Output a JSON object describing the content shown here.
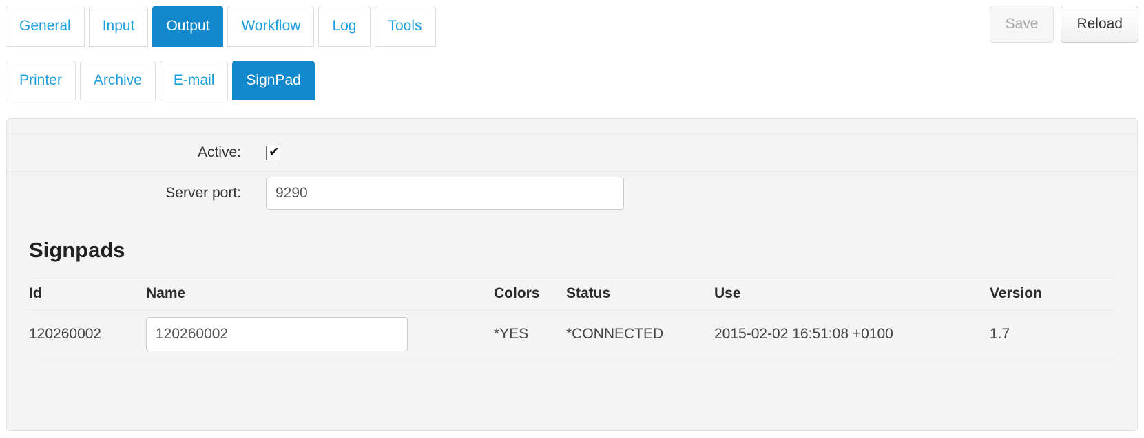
{
  "primary_tabs": [
    {
      "label": "General",
      "active": false
    },
    {
      "label": "Input",
      "active": false
    },
    {
      "label": "Output",
      "active": true
    },
    {
      "label": "Workflow",
      "active": false
    },
    {
      "label": "Log",
      "active": false
    },
    {
      "label": "Tools",
      "active": false
    }
  ],
  "secondary_tabs": [
    {
      "label": "Printer",
      "active": false
    },
    {
      "label": "Archive",
      "active": false
    },
    {
      "label": "E-mail",
      "active": false
    },
    {
      "label": "SignPad",
      "active": true
    }
  ],
  "toolbar": {
    "save_label": "Save",
    "reload_label": "Reload"
  },
  "form": {
    "active_label": "Active:",
    "active_checked": true,
    "check_glyph": "✔",
    "server_port_label": "Server port:",
    "server_port_value": "9290",
    "server_port_placeholder": ""
  },
  "signpads": {
    "heading": "Signpads",
    "columns": [
      "Id",
      "Name",
      "Colors",
      "Status",
      "Use",
      "Version"
    ],
    "rows": [
      {
        "id": "120260002",
        "name": "120260002",
        "name_placeholder": "",
        "colors": "*YES",
        "status": "*CONNECTED",
        "use": "2015-02-02 16:51:08 +0100",
        "version": "1.7"
      }
    ]
  },
  "colors": {
    "accent": "#1189cc",
    "link": "#1e9fdd",
    "panel_bg": "#f4f4f4",
    "panel_border": "#e3e3e3"
  }
}
